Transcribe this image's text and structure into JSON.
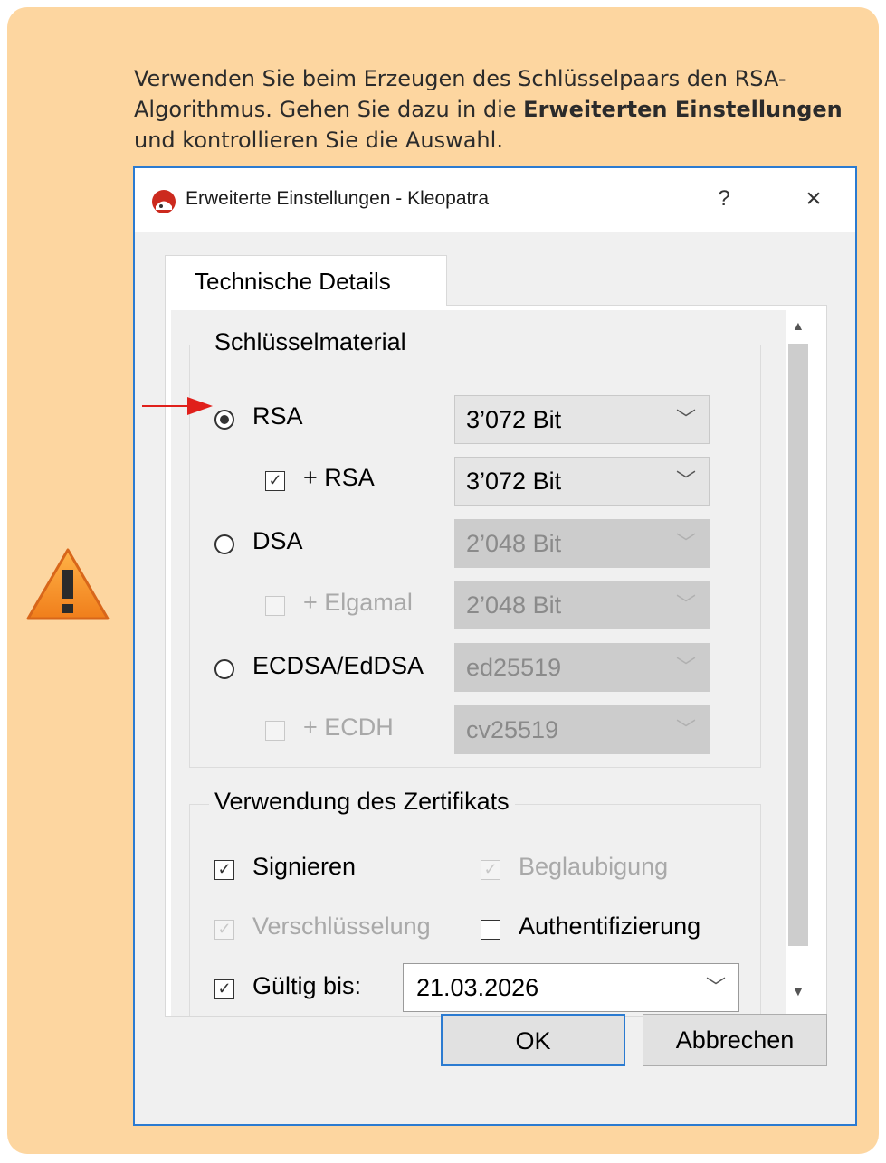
{
  "note": {
    "text_before": "Verwenden Sie beim Erzeugen des Schlüsselpaars den RSA-Algorithmus. Gehen Sie dazu in die ",
    "text_bold": "Erweiterten Einstellungen",
    "text_after": " und kontrollieren Sie die Auswahl.",
    "icon": "warning-icon"
  },
  "dialog": {
    "title": "Erweiterte Einstellungen - Kleopatra",
    "help_label": "?",
    "close_label": "×",
    "tab_label": "Technische Details",
    "key_material": {
      "title": "Schlüsselmaterial",
      "rows": [
        {
          "control": "radio",
          "checked": true,
          "label": "RSA",
          "value": "3’072 Bit",
          "enabled": true
        },
        {
          "control": "checkbox",
          "checked": true,
          "label": "+ RSA",
          "value": "3’072 Bit",
          "enabled": true
        },
        {
          "control": "radio",
          "checked": false,
          "label": "DSA",
          "value": "2’048 Bit",
          "enabled": false
        },
        {
          "control": "checkbox",
          "checked": false,
          "label": "+ Elgamal",
          "value": "2’048 Bit",
          "enabled": false
        },
        {
          "control": "radio",
          "checked": false,
          "label": "ECDSA/EdDSA",
          "value": "ed25519",
          "enabled": false
        },
        {
          "control": "checkbox",
          "checked": false,
          "label": "+ ECDH",
          "value": "cv25519",
          "enabled": false
        }
      ]
    },
    "usage": {
      "title": "Verwendung des Zertifikats",
      "signing": "Signieren",
      "certification": "Beglaubigung",
      "encryption": "Verschlüsselung",
      "authentication": "Authentifizierung",
      "valid_until_label": "Gültig bis:",
      "valid_until_value": "21.03.2026"
    },
    "ok_label": "OK",
    "cancel_label": "Abbrechen"
  },
  "colors": {
    "note_bg": "#fdd6a0",
    "dialog_border": "#2b7bd1",
    "arrow": "#e0201b"
  }
}
